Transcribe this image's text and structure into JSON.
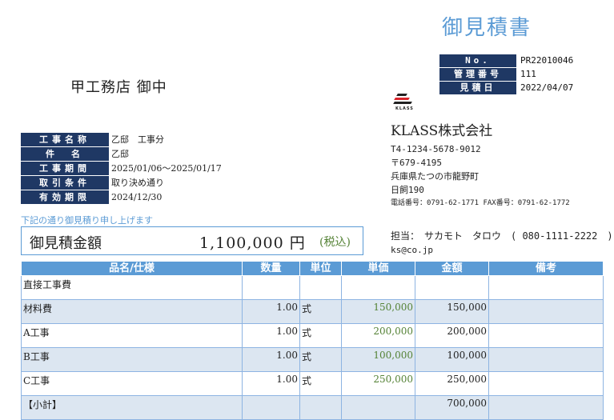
{
  "title": "御見積書",
  "info": [
    {
      "label": "No.",
      "value": "PR22010046"
    },
    {
      "label": "管理番号",
      "value": "111"
    },
    {
      "label": "見積日",
      "value": "2022/04/07"
    }
  ],
  "client": "甲工務店 御中",
  "logo_text": "KLASS",
  "company": {
    "name": "KLASS株式会社",
    "reg": "T4-1234-5678-9012",
    "zip": "〒679-4195",
    "addr1": "兵庫県たつの市龍野町",
    "addr2": "日飼190",
    "phone": "電話番号：0791-62-1771 FAX番号：0791-62-1772"
  },
  "project": [
    {
      "label": "工事名称",
      "value": "乙邸　工事分"
    },
    {
      "label": "件　名",
      "value": "乙邸"
    },
    {
      "label": "工事期間",
      "value": "2025/01/06～2025/01/17"
    },
    {
      "label": "取引条件",
      "value": "取り決め通り"
    },
    {
      "label": "有効期限",
      "value": "2024/12/30"
    }
  ],
  "note": "下記の通り御見積り申し上げます",
  "total": {
    "label": "御見積金額",
    "amount": "1,100,000 円",
    "tax": "(税込)"
  },
  "contact": {
    "line": "担当：　サカモト　タロウ　( 080-1111-2222　)",
    "email": "ks@co.jp"
  },
  "headers": [
    "品名/仕様",
    "数量",
    "単位",
    "単価",
    "金額",
    "備考"
  ],
  "rows": [
    {
      "name": "直接工事費",
      "qty": "",
      "unit": "",
      "price": "",
      "amount": "",
      "note": ""
    },
    {
      "name": "材料費",
      "qty": "1.00",
      "unit": "式",
      "price": "150,000",
      "amount": "150,000",
      "note": ""
    },
    {
      "name": "A工事",
      "qty": "1.00",
      "unit": "式",
      "price": "200,000",
      "amount": "200,000",
      "note": ""
    },
    {
      "name": "B工事",
      "qty": "1.00",
      "unit": "式",
      "price": "100,000",
      "amount": "100,000",
      "note": ""
    },
    {
      "name": "C工事",
      "qty": "1.00",
      "unit": "式",
      "price": "250,000",
      "amount": "250,000",
      "note": ""
    },
    {
      "name": "【小計】",
      "qty": "",
      "unit": "",
      "price": "",
      "amount": "700,000",
      "note": ""
    }
  ]
}
